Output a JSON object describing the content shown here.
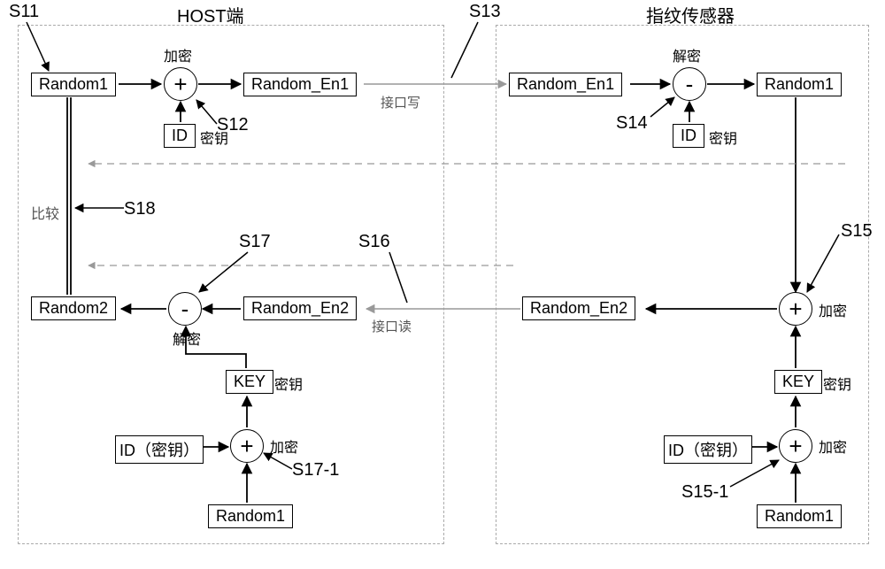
{
  "zones": {
    "host_title": "HOST端",
    "sensor_title": "指纹传感器"
  },
  "steps": {
    "s11": "S11",
    "s12": "S12",
    "s13": "S13",
    "s14": "S14",
    "s15": "S15",
    "s15_1": "S15-1",
    "s16": "S16",
    "s17": "S17",
    "s17_1": "S17-1",
    "s18": "S18"
  },
  "boxes": {
    "random1_a": "Random1",
    "random_en1_a": "Random_En1",
    "random_en1_b": "Random_En1",
    "random1_b": "Random1",
    "id_a": "ID",
    "id_b": "ID",
    "random2": "Random2",
    "random_en2_a": "Random_En2",
    "random_en2_b": "Random_En2",
    "key_a": "KEY",
    "key_b": "KEY",
    "id_paren_a": "ID（密钥）",
    "id_paren_b": "ID（密钥）",
    "random1_c": "Random1",
    "random1_d": "Random1"
  },
  "ops": {
    "plus": "+",
    "minus": "-"
  },
  "labels": {
    "encrypt": "加密",
    "decrypt": "解密",
    "key": "密钥",
    "if_write": "接口写",
    "if_read": "接口读",
    "compare": "比较"
  }
}
